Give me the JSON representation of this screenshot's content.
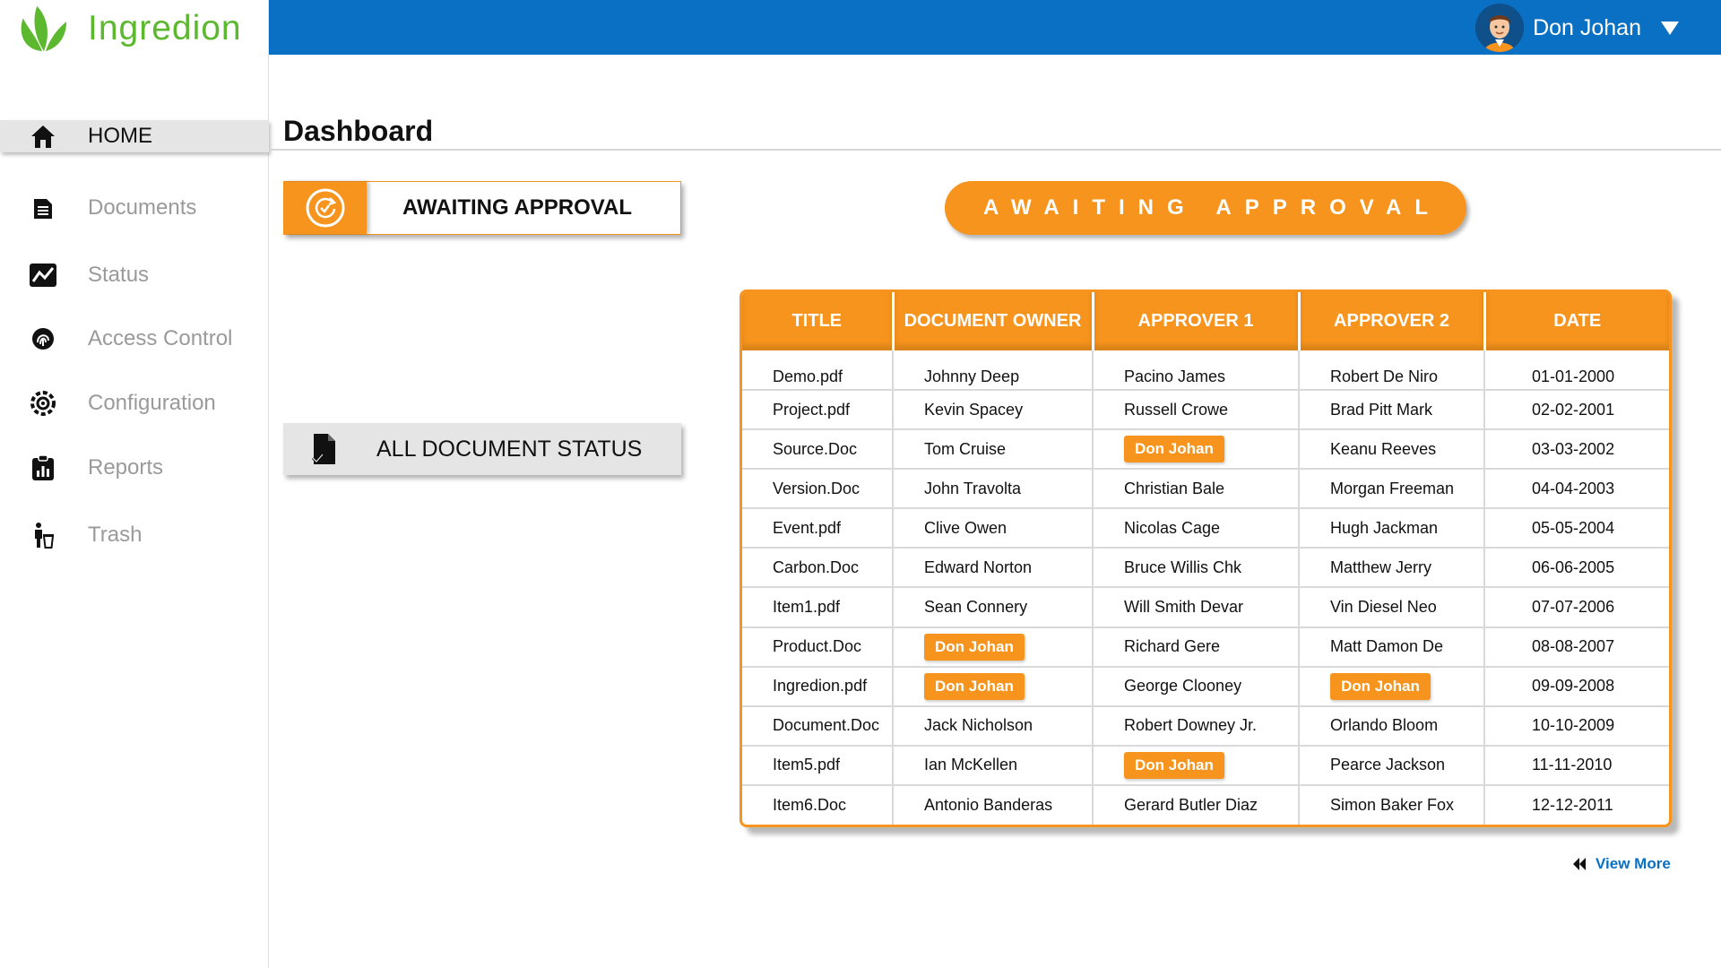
{
  "brand": {
    "name": "Ingredion",
    "color": "#5cb82f"
  },
  "header": {
    "user_name": "Don Johan",
    "bar_color": "#0a70c4"
  },
  "sidebar": {
    "items": [
      {
        "label": "HOME",
        "icon": "home-icon",
        "active": true
      },
      {
        "label": "Documents",
        "icon": "document-icon",
        "active": false
      },
      {
        "label": "Status",
        "icon": "status-chart-icon",
        "active": false
      },
      {
        "label": "Access Control",
        "icon": "fingerprint-icon",
        "active": false
      },
      {
        "label": "Configuration",
        "icon": "gear-icon",
        "active": false
      },
      {
        "label": "Reports",
        "icon": "clipboard-chart-icon",
        "active": false
      },
      {
        "label": "Trash",
        "icon": "trash-person-icon",
        "active": false
      }
    ]
  },
  "main": {
    "title": "Dashboard",
    "awaiting_card": "AWAITING APPROVAL",
    "status_card": "ALL DOCUMENT STATUS",
    "awaiting_pill": "AWAITING APPROVAL",
    "view_more": "View More",
    "accent": "#f7941d"
  },
  "table": {
    "headers": [
      "TITLE",
      "DOCUMENT OWNER",
      "APPROVER 1",
      "APPROVER 2",
      "DATE"
    ],
    "highlight_name": "Don Johan",
    "rows": [
      [
        "Demo.pdf",
        "Johnny Deep",
        "Pacino James",
        "Robert De Niro",
        "01-01-2000"
      ],
      [
        "Project.pdf",
        "Kevin Spacey",
        "Russell Crowe",
        "Brad Pitt Mark",
        "02-02-2001"
      ],
      [
        "Source.Doc",
        "Tom Cruise",
        "Don Johan",
        "Keanu Reeves",
        "03-03-2002"
      ],
      [
        "Version.Doc",
        "John Travolta",
        "Christian Bale",
        "Morgan Freeman",
        "04-04-2003"
      ],
      [
        "Event.pdf",
        "Clive Owen",
        "Nicolas Cage",
        "Hugh Jackman",
        "05-05-2004"
      ],
      [
        "Carbon.Doc",
        "Edward Norton",
        "Bruce Willis Chk",
        "Matthew Jerry",
        "06-06-2005"
      ],
      [
        "Item1.pdf",
        "Sean Connery",
        "Will Smith Devar",
        "Vin Diesel Neo",
        "07-07-2006"
      ],
      [
        "Product.Doc",
        "Don Johan",
        "Richard Gere",
        "Matt Damon De",
        "08-08-2007"
      ],
      [
        "Ingredion.pdf",
        "Don Johan",
        "George Clooney",
        "Don Johan",
        "09-09-2008"
      ],
      [
        "Document.Doc",
        "Jack Nicholson",
        "Robert Downey Jr.",
        "Orlando Bloom",
        "10-10-2009"
      ],
      [
        "Item5.pdf",
        "Ian McKellen",
        "Don Johan",
        "Pearce Jackson",
        "11-11-2010"
      ],
      [
        "Item6.Doc",
        "Antonio Banderas",
        "Gerard Butler Diaz",
        "Simon Baker Fox",
        "12-12-2011"
      ]
    ]
  }
}
